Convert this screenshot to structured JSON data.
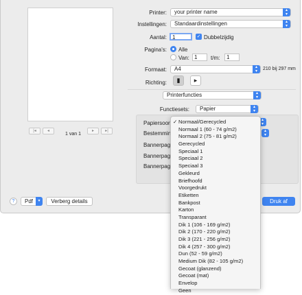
{
  "preview": {
    "page_indicator": "1 van 1",
    "nav": [
      "first",
      "previous",
      "next",
      "last"
    ]
  },
  "printer": {
    "label": "Printer:",
    "value": "your printer name"
  },
  "settings": {
    "label": "Instellingen:",
    "value": "Standaardinstellingen"
  },
  "copies": {
    "label": "Aantal:",
    "value": "1",
    "duplex_label": "Dubbelzijdig",
    "duplex_checked": true
  },
  "pages": {
    "label": "Pagina's:",
    "all_label": "Alle",
    "from_label": "Van:",
    "from_value": "1",
    "to_label": "t/m:",
    "to_value": "1"
  },
  "format": {
    "label": "Formaat:",
    "value": "A4",
    "size_text": "210 bij 297 mm"
  },
  "orientation": {
    "label": "Richting:",
    "selected": "portrait"
  },
  "printer_features": {
    "value": "Printerfuncties"
  },
  "feature_sets": {
    "label": "Functiesets:",
    "value": "Papier"
  },
  "panel": {
    "labels": [
      "Papiersoort",
      "Bestemming",
      "Bannerpagina",
      "Bannerpagina",
      "Bannerpagina"
    ]
  },
  "bottom": {
    "help": "?",
    "pdf_label": "Pdf",
    "details_label": "Verberg details",
    "print_label": "Druk af"
  },
  "paper_menu": {
    "selected_index": 0,
    "items": [
      "Normaal/Gerecycled",
      "Normaal 1 (60 - 74 g/m2)",
      "Normaal 2 (75 - 81 g/m2)",
      "Gerecycled",
      "Speciaal 1",
      "Speciaal 2",
      "Speciaal 3",
      "Gekleurd",
      "Briefhoofd",
      "Voorgedrukt",
      "Etiketten",
      "Bankpost",
      "Karton",
      "Transparant",
      "Dik 1 (106 - 169 g/m2)",
      "Dik 2 (170 - 220 g/m2)",
      "Dik 3 (221 - 256 g/m2)",
      "Dik 4 (257 - 300 g/m2)",
      "Dun (52 - 59 g/m2)",
      "Medium Dik (82 - 105 g/m2)",
      "Gecoat (glanzend)",
      "Gecoat (mat)",
      "Envelop",
      "Geen"
    ]
  },
  "colors": {
    "accent": "#3f84f0",
    "window_bg": "#ececec"
  }
}
